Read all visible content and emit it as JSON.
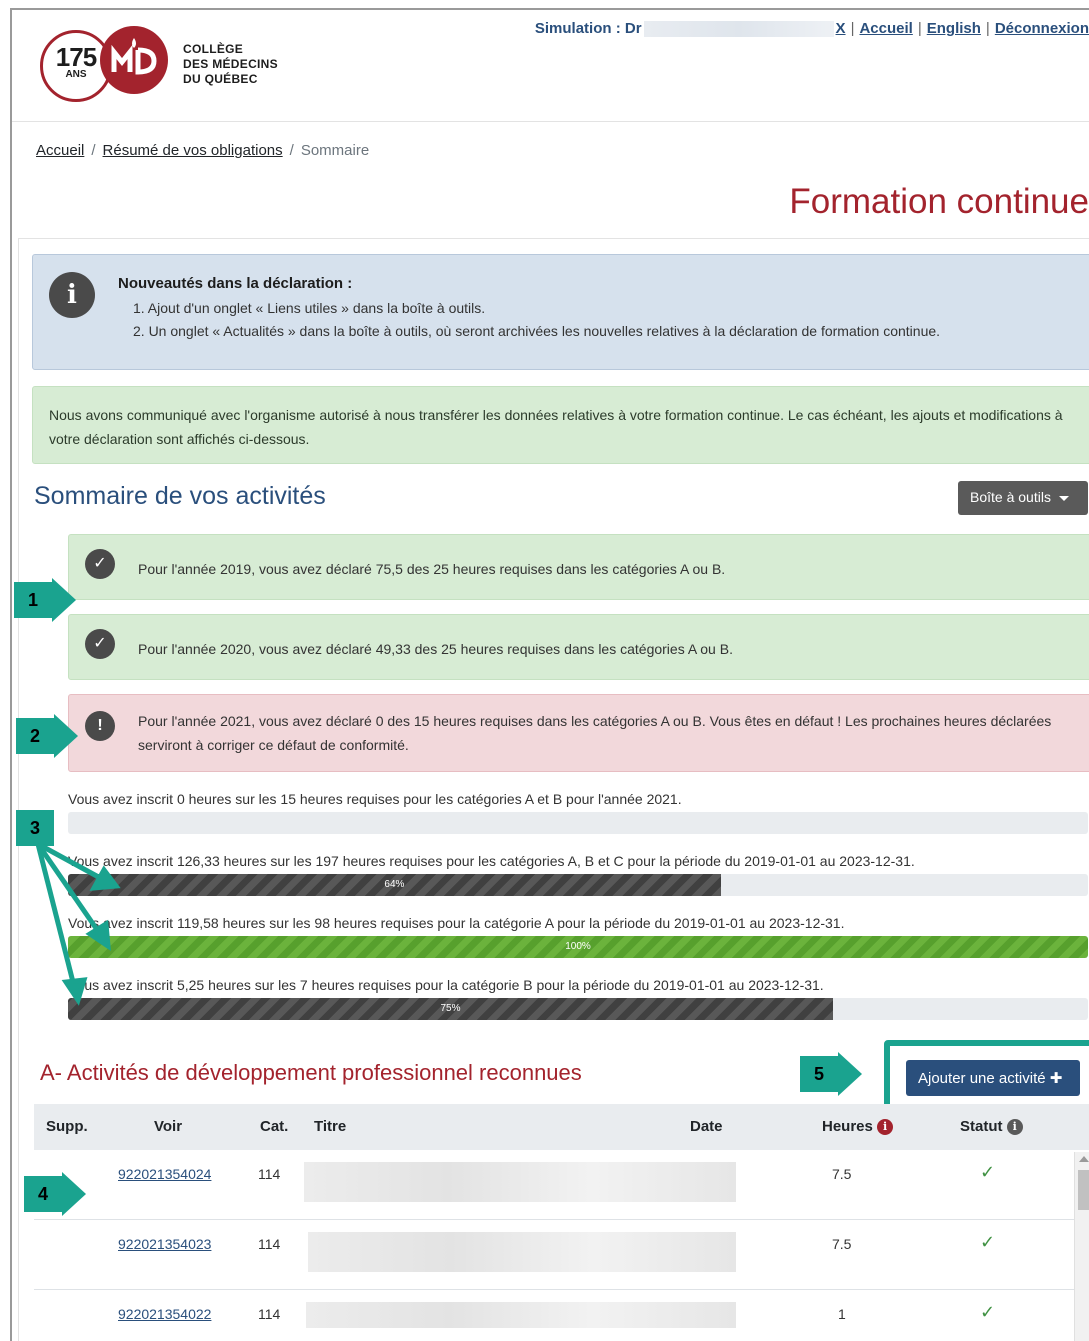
{
  "header": {
    "logo_years": "175",
    "logo_ans": "ANS",
    "logo_lines": [
      "COLLÈGE",
      "DES MÉDECINS",
      "DU QUÉBEC"
    ],
    "simulation_label": "Simulation : Dr",
    "close_label": "X",
    "links": [
      "Accueil",
      "English",
      "Déconnexion"
    ]
  },
  "breadcrumb": [
    "Accueil",
    "Résumé de vos obligations",
    "Sommaire"
  ],
  "page_title": "Formation continue",
  "info_alert": {
    "title": "Nouveautés dans la déclaration :",
    "items": [
      "1. Ajout d'un onglet « Liens utiles » dans la boîte à outils.",
      "2. Un onglet « Actualités » dans la boîte à outils, où seront archivées les nouvelles relatives à la déclaration de formation continue."
    ]
  },
  "success_note": "Nous avons communiqué avec l'organisme autorisé à nous transférer les données relatives à votre formation continue. Le cas échéant, les ajouts et modifications à votre déclaration sont affichés ci-dessous.",
  "summary_title": "Sommaire de vos activités",
  "toolbox_label": "Boîte à outils",
  "alerts": [
    "Pour l'année 2019, vous avez déclaré 75,5 des 25 heures requises dans les catégories A ou B.",
    "Pour l'année 2020, vous avez déclaré 49,33 des 25 heures requises dans les catégories A ou B.",
    "Pour l'année 2021, vous avez déclaré 0 des 15 heures requises dans les catégories A ou B. Vous êtes en défaut ! Les prochaines heures déclarées serviront à corriger ce défaut de conformité."
  ],
  "progress": [
    {
      "text": "Vous avez inscrit 0 heures sur les 15 heures requises pour les catégories A et B pour l'année 2021.",
      "percent": 0,
      "label": ""
    },
    {
      "text": "Vous avez inscrit 126,33 heures sur les 197 heures requises pour les catégories A, B et C pour la période du 2019-01-01 au 2023-12-31.",
      "percent": 64,
      "label": "64%"
    },
    {
      "text": "Vous avez inscrit 119,58 heures sur les 98 heures requises pour la catégorie A pour la période du 2019-01-01 au 2023-12-31.",
      "percent": 100,
      "label": "100%"
    },
    {
      "text": "Vous avez inscrit 5,25 heures sur les 7 heures requises pour la catégorie B pour la période du 2019-01-01 au 2023-12-31.",
      "percent": 75,
      "label": "75%"
    }
  ],
  "sectionA": {
    "title": "A- Activités de développement professionnel reconnues",
    "add_label": "Ajouter une activité",
    "columns": [
      "Supp.",
      "Voir",
      "Cat.",
      "Titre",
      "Date",
      "Heures",
      "Statut"
    ],
    "rows": [
      {
        "voir": "922021354024",
        "cat": "114",
        "heures": "7.5"
      },
      {
        "voir": "922021354023",
        "cat": "114",
        "heures": "7.5"
      },
      {
        "voir": "922021354022",
        "cat": "114",
        "heures": "1"
      }
    ]
  },
  "callouts": [
    "1",
    "2",
    "3",
    "4",
    "5"
  ],
  "colors": {
    "brand_red": "#a3232d",
    "navy": "#2a4f7c",
    "teal_callout": "#1aa38f",
    "success_bg": "#d7ecd4",
    "danger_bg": "#f2d8db"
  }
}
